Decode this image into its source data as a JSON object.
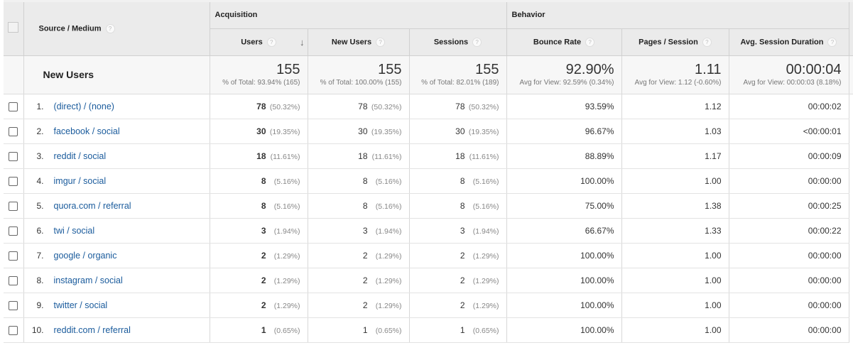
{
  "header": {
    "dimension_label": "Source / Medium",
    "groups": [
      {
        "label": "Acquisition"
      },
      {
        "label": "Behavior"
      }
    ],
    "columns": [
      {
        "label": "Users",
        "sorted": true
      },
      {
        "label": "New Users"
      },
      {
        "label": "Sessions"
      },
      {
        "label": "Bounce Rate"
      },
      {
        "label": "Pages / Session"
      },
      {
        "label": "Avg. Session Duration"
      }
    ],
    "help_glyph": "?",
    "sort_glyph": "↓"
  },
  "summary": {
    "title": "New Users",
    "cells": [
      {
        "value": "155",
        "sub": "% of Total: 93.94% (165)"
      },
      {
        "value": "155",
        "sub": "% of Total: 100.00% (155)"
      },
      {
        "value": "155",
        "sub": "% of Total: 82.01% (189)"
      },
      {
        "value": "92.90%",
        "sub": "Avg for View: 92.59% (0.34%)"
      },
      {
        "value": "1.11",
        "sub": "Avg for View: 1.12 (-0.60%)"
      },
      {
        "value": "00:00:04",
        "sub": "Avg for View: 00:00:03 (8.18%)"
      }
    ]
  },
  "rows": [
    {
      "index": "1.",
      "source": "(direct) / (none)",
      "users": "78",
      "users_pct": "(50.32%)",
      "new_users": "78",
      "new_users_pct": "(50.32%)",
      "sessions": "78",
      "sessions_pct": "(50.32%)",
      "bounce_rate": "93.59%",
      "pages_session": "1.12",
      "avg_duration": "00:00:02"
    },
    {
      "index": "2.",
      "source": "facebook / social",
      "users": "30",
      "users_pct": "(19.35%)",
      "new_users": "30",
      "new_users_pct": "(19.35%)",
      "sessions": "30",
      "sessions_pct": "(19.35%)",
      "bounce_rate": "96.67%",
      "pages_session": "1.03",
      "avg_duration": "<00:00:01"
    },
    {
      "index": "3.",
      "source": "reddit / social",
      "users": "18",
      "users_pct": "(11.61%)",
      "new_users": "18",
      "new_users_pct": "(11.61%)",
      "sessions": "18",
      "sessions_pct": "(11.61%)",
      "bounce_rate": "88.89%",
      "pages_session": "1.17",
      "avg_duration": "00:00:09"
    },
    {
      "index": "4.",
      "source": "imgur / social",
      "users": "8",
      "users_pct": "(5.16%)",
      "new_users": "8",
      "new_users_pct": "(5.16%)",
      "sessions": "8",
      "sessions_pct": "(5.16%)",
      "bounce_rate": "100.00%",
      "pages_session": "1.00",
      "avg_duration": "00:00:00"
    },
    {
      "index": "5.",
      "source": "quora.com / referral",
      "users": "8",
      "users_pct": "(5.16%)",
      "new_users": "8",
      "new_users_pct": "(5.16%)",
      "sessions": "8",
      "sessions_pct": "(5.16%)",
      "bounce_rate": "75.00%",
      "pages_session": "1.38",
      "avg_duration": "00:00:25"
    },
    {
      "index": "6.",
      "source": "twi / social",
      "users": "3",
      "users_pct": "(1.94%)",
      "new_users": "3",
      "new_users_pct": "(1.94%)",
      "sessions": "3",
      "sessions_pct": "(1.94%)",
      "bounce_rate": "66.67%",
      "pages_session": "1.33",
      "avg_duration": "00:00:22"
    },
    {
      "index": "7.",
      "source": "google / organic",
      "users": "2",
      "users_pct": "(1.29%)",
      "new_users": "2",
      "new_users_pct": "(1.29%)",
      "sessions": "2",
      "sessions_pct": "(1.29%)",
      "bounce_rate": "100.00%",
      "pages_session": "1.00",
      "avg_duration": "00:00:00"
    },
    {
      "index": "8.",
      "source": "instagram / social",
      "users": "2",
      "users_pct": "(1.29%)",
      "new_users": "2",
      "new_users_pct": "(1.29%)",
      "sessions": "2",
      "sessions_pct": "(1.29%)",
      "bounce_rate": "100.00%",
      "pages_session": "1.00",
      "avg_duration": "00:00:00"
    },
    {
      "index": "9.",
      "source": "twitter / social",
      "users": "2",
      "users_pct": "(1.29%)",
      "new_users": "2",
      "new_users_pct": "(1.29%)",
      "sessions": "2",
      "sessions_pct": "(1.29%)",
      "bounce_rate": "100.00%",
      "pages_session": "1.00",
      "avg_duration": "00:00:00"
    },
    {
      "index": "10.",
      "source": "reddit.com / referral",
      "users": "1",
      "users_pct": "(0.65%)",
      "new_users": "1",
      "new_users_pct": "(0.65%)",
      "sessions": "1",
      "sessions_pct": "(0.65%)",
      "bounce_rate": "100.00%",
      "pages_session": "1.00",
      "avg_duration": "00:00:00"
    }
  ]
}
